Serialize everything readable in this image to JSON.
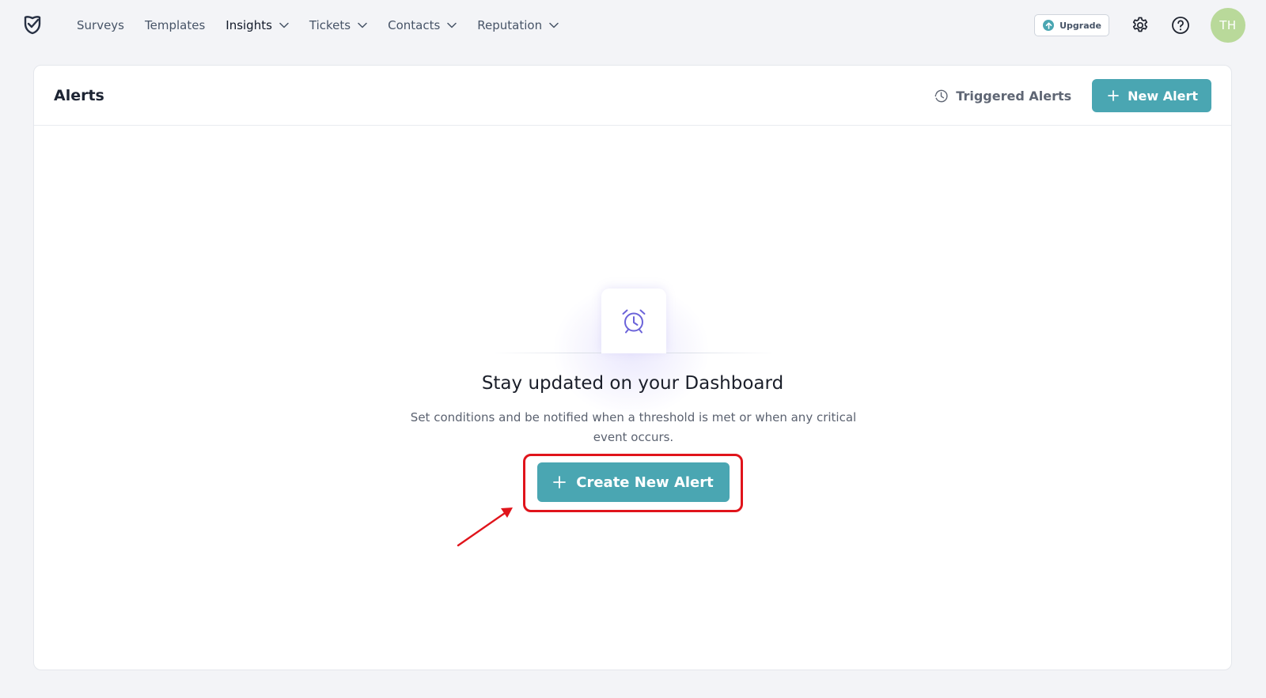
{
  "nav": {
    "items": [
      {
        "label": "Surveys",
        "has_menu": false,
        "active": false
      },
      {
        "label": "Templates",
        "has_menu": false,
        "active": false
      },
      {
        "label": "Insights",
        "has_menu": true,
        "active": true
      },
      {
        "label": "Tickets",
        "has_menu": true,
        "active": false
      },
      {
        "label": "Contacts",
        "has_menu": true,
        "active": false
      },
      {
        "label": "Reputation",
        "has_menu": true,
        "active": false
      }
    ]
  },
  "toolbar": {
    "upgrade_label": "Upgrade",
    "settings_icon": "gear-icon",
    "help_icon": "help-icon",
    "avatar_initials": "TH"
  },
  "alerts": {
    "title": "Alerts",
    "triggered_label": "Triggered Alerts",
    "new_alert_label": "New Alert"
  },
  "empty_state": {
    "icon": "alarm-clock-icon",
    "title": "Stay updated on your Dashboard",
    "description": "Set conditions and be notified when a threshold is met or when any critical event occurs.",
    "cta_label": "Create New Alert"
  },
  "colors": {
    "accent": "#4aa6b2",
    "annotation": "#e0141b",
    "avatar_bg": "#b9d99a",
    "icon_purple": "#6b63d9"
  }
}
